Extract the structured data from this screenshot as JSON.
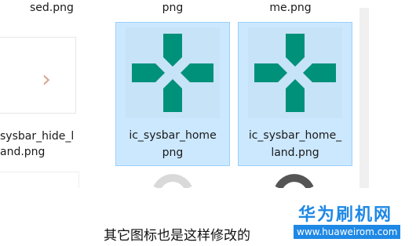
{
  "explorer": {
    "top_row": {
      "item1_name": "sed.png",
      "item2_name": "png",
      "item3_name": "me.png"
    },
    "items": [
      {
        "name_line1": "sysbar_hide_l",
        "name_line2": "and.png",
        "selected": false
      },
      {
        "name_line1": "ic_sysbar_home",
        "name_line2": "png",
        "selected": true
      },
      {
        "name_line1": "ic_sysbar_home_",
        "name_line2": "land.png",
        "selected": true
      }
    ],
    "icon_color": "#00917a",
    "selection_color": "#cce8ff"
  },
  "caption": "其它图标也是这样修改的",
  "watermark": {
    "site_name": "华为刷机网",
    "url": "www.huaweirom.com"
  }
}
